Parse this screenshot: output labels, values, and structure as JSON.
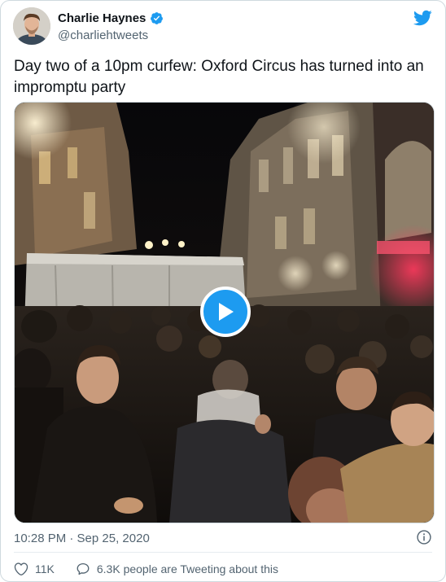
{
  "author": {
    "display_name": "Charlie Haynes",
    "handle": "@charliehtweets",
    "verified": true
  },
  "tweet": {
    "text": "Day two of a 10pm curfew: Oxford Circus has turned into an impromptu party",
    "timestamp": "10:28 PM · Sep 25, 2020"
  },
  "media": {
    "type": "video",
    "play_icon": "play-icon"
  },
  "actions": {
    "likes": "11K",
    "conversation": "6.3K people are Tweeting about this"
  },
  "colors": {
    "accent": "#1d9bf0",
    "text": "#0f1419",
    "muted": "#536471",
    "border": "#cfd9de"
  },
  "icons": [
    "verified-badge-icon",
    "twitter-bird-icon",
    "info-icon",
    "heart-icon",
    "speech-bubble-icon",
    "play-icon"
  ]
}
